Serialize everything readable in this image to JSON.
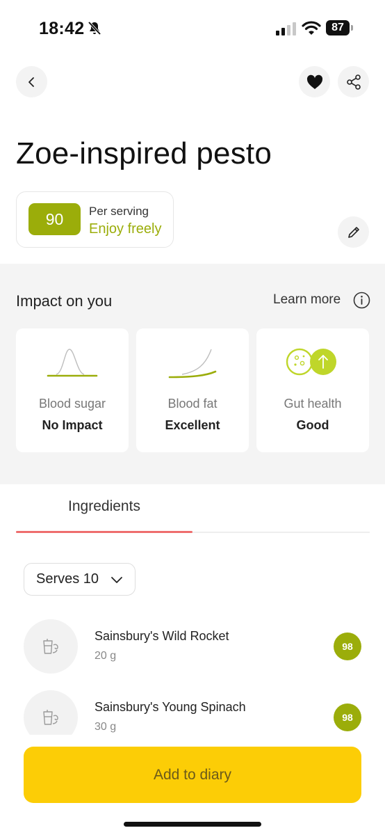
{
  "status_bar": {
    "time": "18:42",
    "battery": "87"
  },
  "recipe": {
    "title": "Zoe-inspired pesto",
    "score": "90",
    "per_serving": "Per serving",
    "verdict": "Enjoy freely"
  },
  "impact": {
    "title": "Impact on you",
    "learn_more": "Learn more",
    "cards": [
      {
        "label": "Blood sugar",
        "value": "No Impact"
      },
      {
        "label": "Blood fat",
        "value": "Excellent"
      },
      {
        "label": "Gut health",
        "value": "Good"
      }
    ]
  },
  "tabs": [
    {
      "label": "Ingredients",
      "active": true
    }
  ],
  "serves": {
    "label": "Serves 10"
  },
  "ingredients": [
    {
      "name": "Sainsbury's Wild Rocket",
      "qty": "20 g",
      "score": "98"
    },
    {
      "name": "Sainsbury's Young Spinach",
      "qty": "30 g",
      "score": "98"
    }
  ],
  "actions": {
    "add_label": "Add to diary"
  },
  "colors": {
    "accent_green": "#9bad0a",
    "cta_yellow": "#fccd06",
    "tab_underline": "#ee6e6e",
    "panel_bg": "#f4f4f4"
  }
}
